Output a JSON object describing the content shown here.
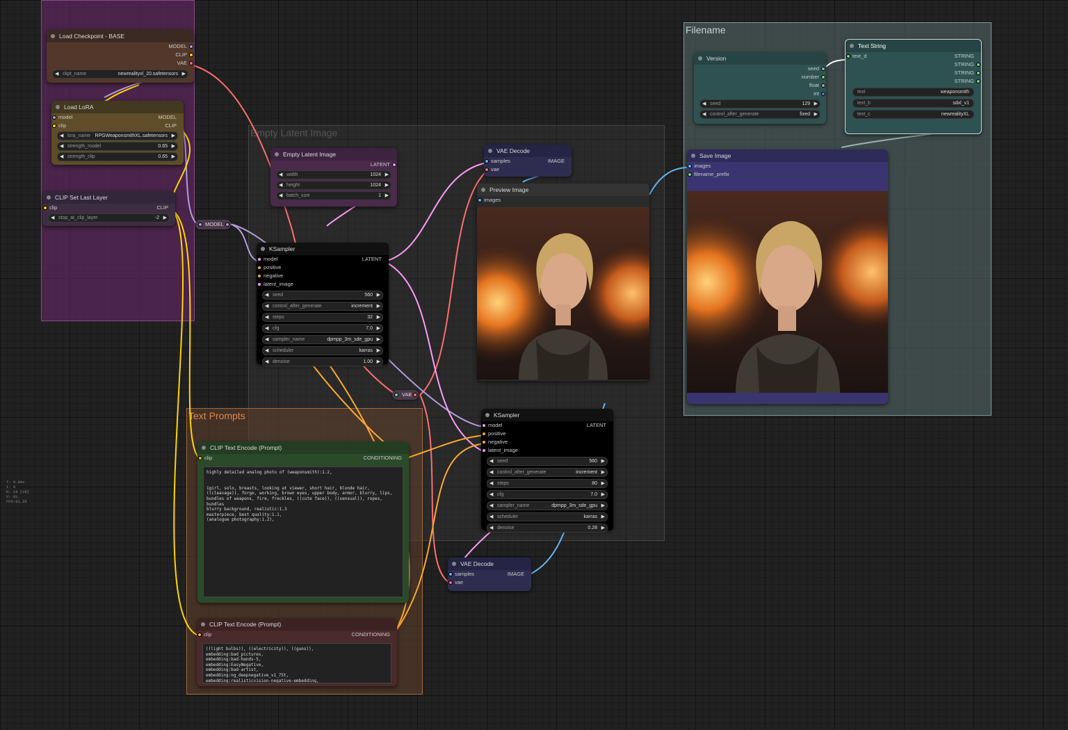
{
  "groups": {
    "filename": "Filename",
    "empty_latent": "Empty Latent Image",
    "text_prompts": "Text Prompts"
  },
  "nodes": {
    "load_checkpoint": {
      "title": "Load Checkpoint - BASE",
      "outputs": [
        "MODEL",
        "CLIP",
        "VAE"
      ],
      "ckpt_name_label": "ckpt_name",
      "ckpt_name_value": "newrealityxl_20.safetensors"
    },
    "load_lora": {
      "title": "Load LoRA",
      "inputs": [
        "model",
        "clip"
      ],
      "outputs": [
        "MODEL",
        "CLIP"
      ],
      "widgets": [
        {
          "label": "lora_name",
          "value": "RPGWeaponsmithXL.safetensors"
        },
        {
          "label": "strength_model",
          "value": "0.65"
        },
        {
          "label": "strength_clip",
          "value": "0.65"
        }
      ]
    },
    "clip_set_last_layer": {
      "title": "CLIP Set Last Layer",
      "input": "clip",
      "output": "CLIP",
      "widget": {
        "label": "stop_at_clip_layer",
        "value": "-2"
      }
    },
    "empty_latent": {
      "title": "Empty Latent Image",
      "output": "LATENT",
      "widgets": [
        {
          "label": "width",
          "value": "1024"
        },
        {
          "label": "height",
          "value": "1024"
        },
        {
          "label": "batch_size",
          "value": "1"
        }
      ]
    },
    "ksampler1": {
      "title": "KSampler",
      "inputs": [
        "model",
        "positive",
        "negative",
        "latent_image"
      ],
      "output": "LATENT",
      "widgets": [
        {
          "label": "seed",
          "value": "560"
        },
        {
          "label": "control_after_generate",
          "value": "increment"
        },
        {
          "label": "steps",
          "value": "32"
        },
        {
          "label": "cfg",
          "value": "7.0"
        },
        {
          "label": "sampler_name",
          "value": "dpmpp_3m_sde_gpu"
        },
        {
          "label": "scheduler",
          "value": "karras"
        },
        {
          "label": "denoise",
          "value": "1.00"
        }
      ]
    },
    "vae_decode1": {
      "title": "VAE Decode",
      "inputs": [
        "samples",
        "vae"
      ],
      "output": "IMAGE"
    },
    "preview_image": {
      "title": "Preview Image",
      "input": "images"
    },
    "ksampler2": {
      "title": "KSampler",
      "inputs": [
        "model",
        "positive",
        "negative",
        "latent_image"
      ],
      "output": "LATENT",
      "widgets": [
        {
          "label": "seed",
          "value": "560"
        },
        {
          "label": "control_after_generate",
          "value": "increment"
        },
        {
          "label": "steps",
          "value": "80"
        },
        {
          "label": "cfg",
          "value": "7.0"
        },
        {
          "label": "sampler_name",
          "value": "dpmpp_3m_sde_gpu"
        },
        {
          "label": "scheduler",
          "value": "karras"
        },
        {
          "label": "denoise",
          "value": "0.28"
        }
      ]
    },
    "vae_decode2": {
      "title": "VAE Decode",
      "inputs": [
        "samples",
        "vae"
      ],
      "output": "IMAGE"
    },
    "clip_pos": {
      "title": "CLIP Text Encode (Prompt)",
      "input": "clip",
      "output": "CONDITIONING",
      "text": "highly detailed analog photo of (weaponsmith):1.2,\n\n\n1girl, solo, breasts, looking at viewer, short hair, blonde hair, ((cleavage)), forge, working, brown eyes, upper body, armor, blurry, lips, bundles of weapons, fire, freckles, ((cute face)), ((sensual)), ropes, bundles\nblurry background, realistic:1.3\nmasterpiece, best quality:1.1,\n(analogue photography:1.2),"
    },
    "clip_neg": {
      "title": "CLIP Text Encode (Prompt)",
      "input": "clip",
      "output": "CONDITIONING",
      "text": "((light bulbs)), ((electricity)), ((guns)),\nembedding:bad_pictures,\nembedding:bad-hands-5,\nembedding:EasyNegative,\nembedding:bad-artist,\nembedding:ng_deepnegative_v1_75t,\nembedding:realisticvision-negative-embedding,"
    },
    "version": {
      "title": "Version",
      "outputs": [
        "seed",
        "number",
        "float",
        "int"
      ],
      "widgets": [
        {
          "label": "seed",
          "value": "129"
        },
        {
          "label": "control_after_generate",
          "value": "fixed"
        }
      ]
    },
    "text_string": {
      "title": "Text String",
      "input": "text_d",
      "outputs": [
        "STRING",
        "STRING",
        "STRING",
        "STRING"
      ],
      "widgets": [
        {
          "label": "text",
          "value": "weaponsmith"
        },
        {
          "label": "text_b",
          "value": "sdxl_v1"
        },
        {
          "label": "text_c",
          "value": "newrealityXL"
        }
      ]
    },
    "save_image": {
      "title": "Save Image",
      "inputs": [
        "images",
        "filename_prefix"
      ]
    }
  },
  "reroutes": {
    "model": "MODEL",
    "vae": "VAE"
  },
  "stats": [
    "T: 0.00s",
    "I: 0",
    "N: 18 [18]",
    "V: 81",
    "FPS:61.35"
  ],
  "colors": {
    "model": "#b39ddb",
    "clip": "#ffd500",
    "vae": "#ff6e6e",
    "latent": "#ff9cf9",
    "image": "#64b5f6",
    "conditioning": "#ffa931"
  }
}
